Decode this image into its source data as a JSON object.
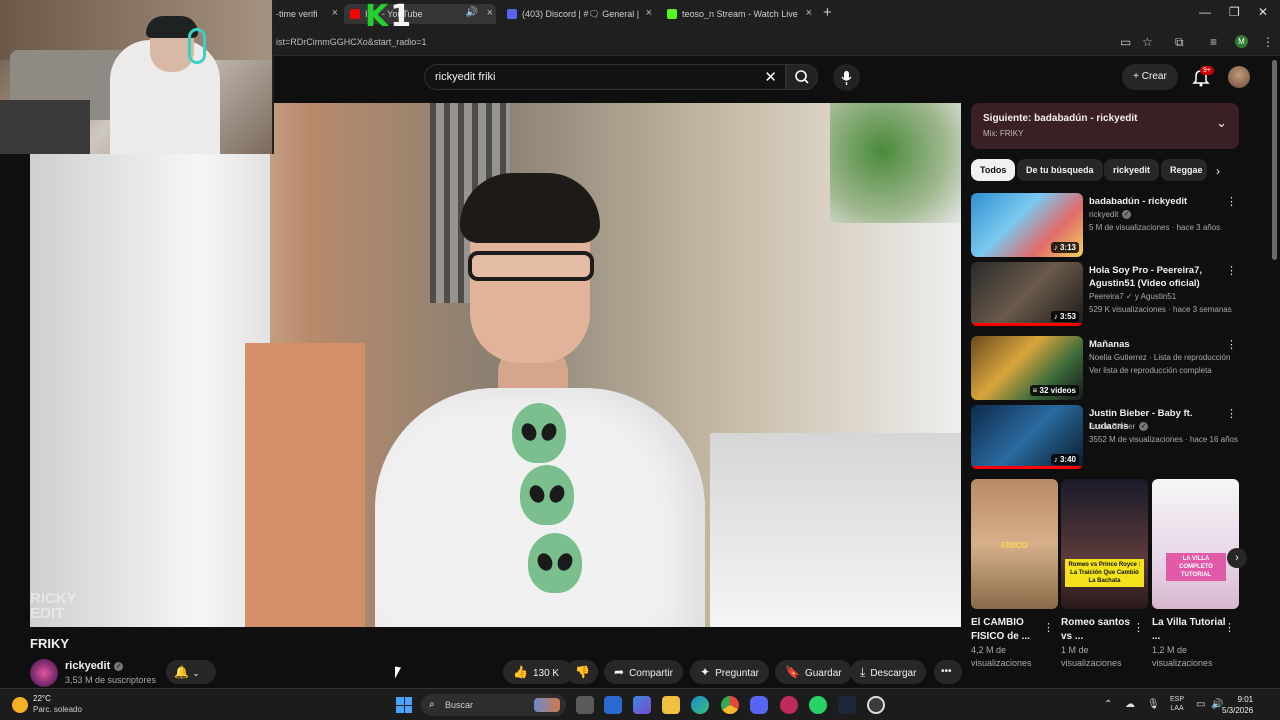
{
  "browser": {
    "tabs": [
      {
        "label": "-time verifi",
        "color": "#555555"
      },
      {
        "label": "IKY - YouTube",
        "color": "#ff0000"
      },
      {
        "label": "(403) Discord | #🗨 General |",
        "color": "#5865f2"
      },
      {
        "label": "teoso_n Stream - Watch Live o",
        "color": "#53fc18"
      }
    ],
    "url": "ist=RDrCimmGGHCXo&start_radio=1",
    "profile_initial": "M"
  },
  "overlay": {
    "logo_k": "K",
    "logo_one": "1"
  },
  "header": {
    "search_value": "rickyedit friki",
    "create_label": "Crear",
    "notification_count": "9+"
  },
  "video": {
    "watermark_line1": "RICKY",
    "watermark_line2": "EDIT",
    "title": "FRIKY",
    "channel": "rickyedit",
    "subscribers": "3,53 M de suscriptores",
    "likes": "130 K",
    "share_label": "Compartir",
    "ask_label": "Preguntar",
    "save_label": "Guardar",
    "download_label": "Descargar"
  },
  "sidebar": {
    "up_next_title": "Siguiente: badabadún - rickyedit",
    "up_next_sub": "Mix: FRIKY",
    "chips": [
      "Todos",
      "De tu búsqueda",
      "rickyedit",
      "Reggae"
    ],
    "recommendations": [
      {
        "title": "badabadún - rickyedit",
        "channel": "rickyedit",
        "meta": "5 M de visualizaciones · hace 3 años",
        "duration": "3:13"
      },
      {
        "title": "Hola Soy Pro - Peereira7, Agustin51 (Video oficial)",
        "channel": "Peereira7 ✓ y Agustin51",
        "meta": "529 K visualizaciones · hace 3 semanas",
        "duration": "3:53"
      },
      {
        "title": "Mañanas",
        "channel": "Noelia Gutierrez · Lista de reproducción",
        "meta": "Ver lista de reproducción completa",
        "duration": "32 videos"
      },
      {
        "title": "Justin Bieber - Baby ft. Ludacris",
        "channel": "Justin Bieber",
        "meta": "3552 M de visualizaciones · hace 16 años",
        "duration": "3:40"
      }
    ],
    "shorts": [
      {
        "title": "El CAMBIO FISICO de ...",
        "views": "4,2 M de visualizaciones",
        "overlay": "FÍSICO"
      },
      {
        "title": "Romeo santos vs ...",
        "views": "1 M de visualizaciones",
        "overlay": "Romeo vs Prince Royce : La Traición Que Cambió La Bachata"
      },
      {
        "title": "La Villa Tutorial ...",
        "views": "1,2 M de visualizaciones",
        "overlay": "LA VILLA COMPLETO TUTORIAL"
      }
    ]
  },
  "taskbar": {
    "temperature": "22°C",
    "weather": "Parc. soleado",
    "search_label": "Buscar",
    "lang_line1": "ESP",
    "lang_line2": "LAA",
    "time": "9:01",
    "date": "5/3/2026"
  }
}
